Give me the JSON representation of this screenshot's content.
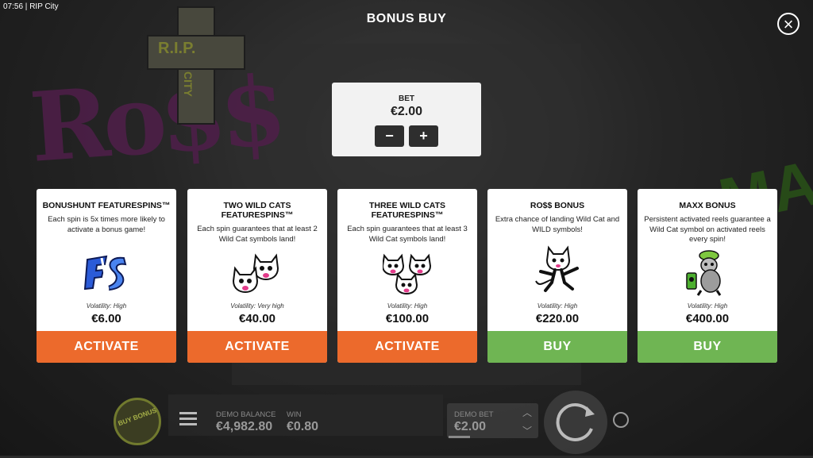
{
  "status": {
    "time": "07:56",
    "app": "RIP City"
  },
  "background": {
    "cross_text_1": "R.I.P.",
    "cross_text_2": "CITY",
    "graffiti_left": "Ro$$",
    "graffiti_right": "MAXX"
  },
  "header": {
    "title": "BONUS BUY",
    "close_icon": "close-icon"
  },
  "bet": {
    "label": "BET",
    "value": "€2.00",
    "minus": "−",
    "plus": "+"
  },
  "cards": [
    {
      "title": "BONUSHUNT FEATURESPINS™",
      "desc": "Each spin is 5x times more likely to activate a bonus game!",
      "volatility": "Volatility: High",
      "price": "€6.00",
      "action": "ACTIVATE",
      "color": "#ec6a2c",
      "image": "fs-logo"
    },
    {
      "title": "TWO WILD CATS FEATURESPINS™",
      "desc": "Each spin guarantees that at least 2 Wild Cat symbols land!",
      "volatility": "Volatility: Very high",
      "price": "€40.00",
      "action": "ACTIVATE",
      "color": "#ec6a2c",
      "image": "two-wild-cats"
    },
    {
      "title": "THREE WILD CATS FEATURESPINS™",
      "desc": "Each spin guarantees that at least 3 Wild Cat symbols land!",
      "volatility": "Volatility: High",
      "price": "€100.00",
      "action": "ACTIVATE",
      "color": "#ec6a2c",
      "image": "three-wild-cats"
    },
    {
      "title": "RO$$ BONUS",
      "desc": "Extra chance of landing Wild Cat and WILD symbols!",
      "volatility": "Volatility: High",
      "price": "€220.00",
      "action": "BUY",
      "color": "#6fb553",
      "image": "ross-cat"
    },
    {
      "title": "MAXX BONUS",
      "desc": "Persistent activated reels guarantee a Wild Cat symbol on activated reels every spin!",
      "volatility": "Volatility: High",
      "price": "€400.00",
      "action": "BUY",
      "color": "#6fb553",
      "image": "maxx-rat"
    }
  ],
  "bottom": {
    "buy_bonus": "BUY BONUS",
    "balance_label": "DEMO BALANCE",
    "balance_value": "€4,982.80",
    "win_label": "WIN",
    "win_value": "€0.80",
    "demo_bet_label": "DEMO BET",
    "demo_bet_value": "€2.00"
  }
}
